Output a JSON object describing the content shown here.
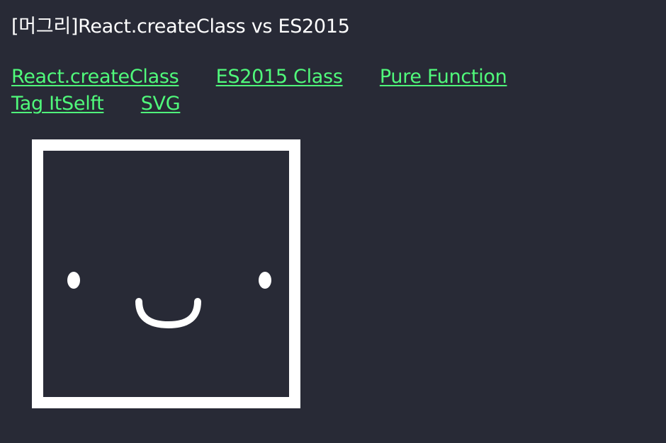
{
  "page": {
    "title": "[머그리]React.createClass vs ES2015"
  },
  "nav": {
    "links": [
      {
        "label": "React.createClass"
      },
      {
        "label": "ES2015 Class"
      },
      {
        "label": "Pure Function"
      },
      {
        "label": "Tag ItSelft"
      },
      {
        "label": "SVG"
      }
    ]
  },
  "colors": {
    "background": "#282a36",
    "link": "#50fa7b",
    "text": "#ffffff",
    "face": "#ffffff"
  },
  "icons": {
    "face": "smiley-face-icon"
  }
}
